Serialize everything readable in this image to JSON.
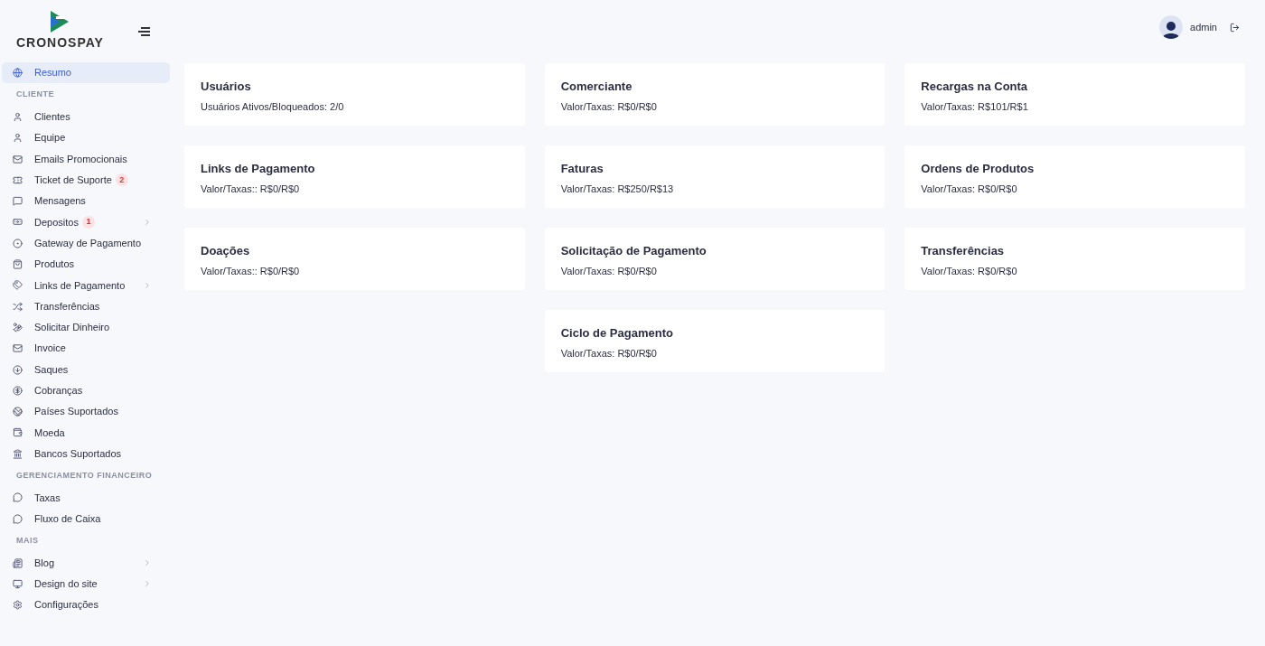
{
  "brand": {
    "name": "CRONOSPAY"
  },
  "user": {
    "name": "admin"
  },
  "sidebar": {
    "sections": [
      {
        "items": [
          {
            "label": "Resumo",
            "selected": true,
            "expandable": false
          }
        ]
      },
      {
        "heading": "CLIENTE",
        "items": [
          {
            "label": "Clientes",
            "selected": false,
            "expandable": false
          },
          {
            "label": "Equipe",
            "selected": false,
            "expandable": false
          },
          {
            "label": "Emails Promocionais",
            "selected": false,
            "expandable": false
          },
          {
            "label": "Ticket de Suporte",
            "badge": "2",
            "selected": false,
            "expandable": false
          },
          {
            "label": "Mensagens",
            "selected": false,
            "expandable": false
          },
          {
            "label": "Depositos",
            "badge": "1",
            "selected": false,
            "expandable": true
          },
          {
            "label": "Gateway de Pagamento",
            "selected": false,
            "expandable": false
          },
          {
            "label": "Produtos",
            "selected": false,
            "expandable": false
          },
          {
            "label": "Links de Pagamento",
            "selected": false,
            "expandable": true
          },
          {
            "label": "Transferências",
            "selected": false,
            "expandable": false
          },
          {
            "label": "Solicitar Dinheiro",
            "selected": false,
            "expandable": false
          },
          {
            "label": "Invoice",
            "selected": false,
            "expandable": false
          },
          {
            "label": "Saques",
            "selected": false,
            "expandable": false
          },
          {
            "label": "Cobranças",
            "selected": false,
            "expandable": false
          },
          {
            "label": "Países Suportados",
            "selected": false,
            "expandable": false
          },
          {
            "label": "Moeda",
            "selected": false,
            "expandable": false
          },
          {
            "label": "Bancos Suportados",
            "selected": false,
            "expandable": false
          }
        ]
      },
      {
        "heading": "GERENCIAMENTO FINANCEIRO",
        "items": [
          {
            "label": "Taxas",
            "selected": false,
            "expandable": false
          },
          {
            "label": "Fluxo de Caixa",
            "selected": false,
            "expandable": false
          }
        ]
      },
      {
        "heading": "MAIS",
        "items": [
          {
            "label": "Blog",
            "selected": false,
            "expandable": true
          },
          {
            "label": "Design do site",
            "selected": false,
            "expandable": true
          },
          {
            "label": "Configurações",
            "selected": false,
            "expandable": false
          }
        ]
      }
    ]
  },
  "card_rows": [
    {
      "cards": [
        {
          "title": "Usuários",
          "detail": "Usuários Ativos/Bloqueados: 2/0"
        },
        {
          "title": "Comerciante",
          "detail": "Valor/Taxas: R$0/R$0"
        },
        {
          "title": "Recargas na Conta",
          "detail": "Valor/Taxas: R$101/R$1"
        }
      ]
    },
    {
      "cards": [
        {
          "title": "Links de Pagamento",
          "detail": "Valor/Taxas:: R$0/R$0"
        },
        {
          "title": "Faturas",
          "detail": "Valor/Taxas: R$250/R$13"
        },
        {
          "title": "Ordens de Produtos",
          "detail": "Valor/Taxas: R$0/R$0"
        }
      ]
    },
    {
      "cards": [
        {
          "title": "Doações",
          "detail": "Valor/Taxas:: R$0/R$0"
        },
        {
          "title": "Solicitação de Pagamento",
          "detail": "Valor/Taxas: R$0/R$0"
        },
        {
          "title": "Transferências",
          "detail": "Valor/Taxas: R$0/R$0"
        }
      ]
    },
    {
      "cards": [
        {
          "title": "Ciclo de Pagamento",
          "detail": "Valor/Taxas: R$0/R$0"
        }
      ]
    }
  ]
}
